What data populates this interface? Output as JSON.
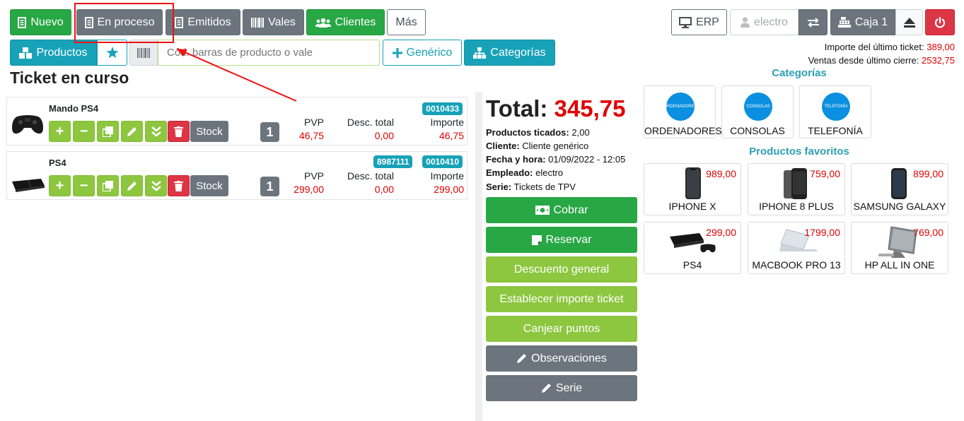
{
  "toolbar": {
    "nuevo": "Nuevo",
    "en_proceso": "En proceso",
    "emitidos": "Emitidos",
    "vales": "Vales",
    "clientes": "Clientes",
    "mas": "Más",
    "erp": "ERP",
    "user": "electro",
    "caja": "Caja 1"
  },
  "second_bar": {
    "productos": "Productos",
    "barcode_placeholder": "Cód. barras de producto o vale",
    "generico": "Genérico",
    "categorias": "Categorías"
  },
  "last_ticket": {
    "importe_label": "Importe del último ticket:",
    "importe_value": "389,00",
    "ventas_label": "Ventas desde último cierre:",
    "ventas_value": "2532,75"
  },
  "ticket": {
    "title": "Ticket en curso",
    "col_pvp": "PVP",
    "col_desc": "Desc. total",
    "col_importe": "Importe",
    "stock_label": "Stock",
    "lines": [
      {
        "name": "Mando PS4",
        "qty": "1",
        "pvp": "46,75",
        "desc": "0,00",
        "importe": "46,75",
        "badges": [
          "0010433"
        ]
      },
      {
        "name": "PS4",
        "qty": "1",
        "pvp": "299,00",
        "desc": "0,00",
        "importe": "299,00",
        "badges": [
          "8987111",
          "0010410"
        ]
      }
    ]
  },
  "summary": {
    "total_label": "Total:",
    "total_value": "345,75",
    "productos_label": "Productos ticados:",
    "productos_value": "2,00",
    "cliente_label": "Cliente:",
    "cliente_value": "Cliente genérico",
    "fecha_label": "Fecha y hora:",
    "fecha_value": "01/09/2022 - 12:05",
    "empleado_label": "Empleado:",
    "empleado_value": "electro",
    "serie_label": "Serie:",
    "serie_value": "Tickets de TPV"
  },
  "actions": {
    "cobrar": "Cobrar",
    "reservar": "Reservar",
    "descuento": "Descuento general",
    "establecer": "Establecer importe ticket",
    "canjear": "Canjear puntos",
    "observaciones": "Observaciones",
    "serie": "Serie"
  },
  "categories": {
    "title": "Categorías",
    "items": [
      {
        "circle": "ORDENADORES",
        "label": "ORDENADORES"
      },
      {
        "circle": "CONSOLAS",
        "label": "CONSOLAS"
      },
      {
        "circle": "TELEFONÍA",
        "label": "TELEFONÍA"
      }
    ]
  },
  "favorites": {
    "title": "Productos favoritos",
    "items": [
      {
        "label": "IPHONE X",
        "price": "989,00"
      },
      {
        "label": "IPHONE 8 PLUS",
        "price": "759,00"
      },
      {
        "label": "SAMSUNG GALAXY",
        "price": "899,00"
      },
      {
        "label": "PS4",
        "price": "299,00"
      },
      {
        "label": "MACBOOK PRO 13",
        "price": "1799,00"
      },
      {
        "label": "HP ALL IN ONE",
        "price": "769,00"
      }
    ]
  },
  "colors": {
    "green": "#28a745",
    "gray": "#6c757d",
    "teal": "#17a2b8",
    "lime": "#8dc63f",
    "red": "#dc3545",
    "price_red": "#e00000",
    "annotation_red": "#e11"
  }
}
